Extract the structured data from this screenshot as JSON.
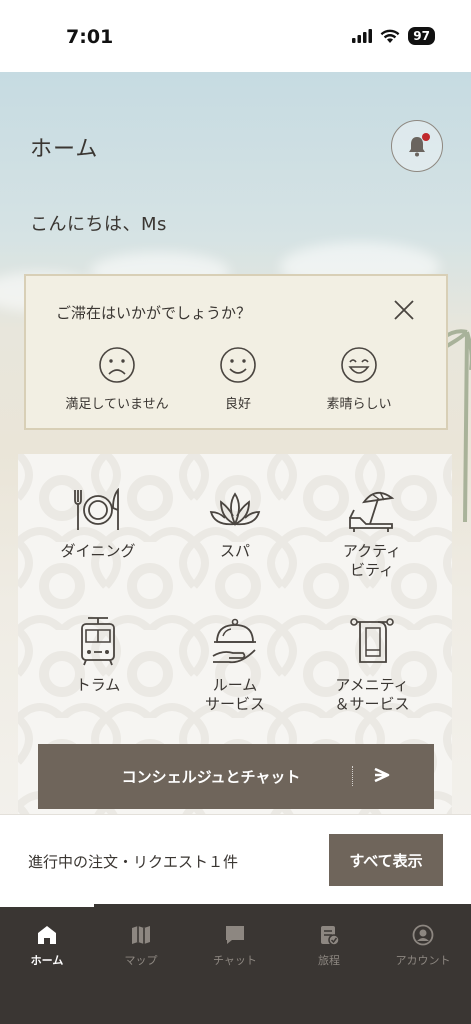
{
  "status_bar": {
    "time": "7:01",
    "battery": "97"
  },
  "header": {
    "title": "ホーム",
    "greeting": "こんにちは、Ms"
  },
  "feedback": {
    "question": "ご滞在はいかがでしょうか？",
    "options": [
      {
        "label": "満足していません",
        "icon": "sad-face-icon"
      },
      {
        "label": "良好",
        "icon": "smile-face-icon"
      },
      {
        "label": "素晴らしい",
        "icon": "happy-face-icon"
      }
    ]
  },
  "services": [
    {
      "label": "ダイニング",
      "icon": "dining-icon"
    },
    {
      "label": "スパ",
      "icon": "spa-lotus-icon"
    },
    {
      "label": "アクティ\nビティ",
      "icon": "beach-umbrella-icon"
    },
    {
      "label": "トラム",
      "icon": "tram-icon"
    },
    {
      "label": "ルーム\nサービス",
      "icon": "room-service-cloche-icon"
    },
    {
      "label": "アメニティ\n＆サービス",
      "icon": "towel-icon"
    }
  ],
  "concierge": {
    "label": "コンシェルジュとチャット",
    "icon": "arrow-right-icon"
  },
  "orders": {
    "text": "進行中の注文・リクエスト１件",
    "button": "すべて表示"
  },
  "tabs": [
    {
      "label": "ホーム",
      "icon": "home-icon",
      "active": true
    },
    {
      "label": "マップ",
      "icon": "map-icon",
      "active": false
    },
    {
      "label": "チャット",
      "icon": "chat-icon",
      "active": false
    },
    {
      "label": "旅程",
      "icon": "itinerary-icon",
      "active": false
    },
    {
      "label": "アカウント",
      "icon": "account-icon",
      "active": false
    }
  ],
  "colors": {
    "accent": "#6f655b",
    "tabbar": "#3a3633",
    "notification": "#c0282c",
    "card": "#f2efe3"
  }
}
